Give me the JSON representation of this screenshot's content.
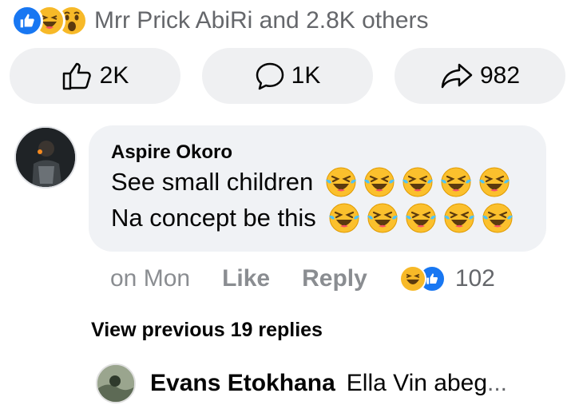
{
  "summary": {
    "reactions": [
      "like-icon",
      "haha-icon",
      "wow-icon"
    ],
    "text": "Mrr Prick AbiRi and 2.8K others"
  },
  "actions": {
    "like_count": "2K",
    "comment_count": "1K",
    "share_count": "982"
  },
  "comment": {
    "author": "Aspire Okoro",
    "line1": "See small children",
    "line2": "Na concept be this",
    "line1_emoji_count": 5,
    "line2_emoji_count": 5,
    "time": "on Mon",
    "like_label": "Like",
    "reply_label": "Reply",
    "reaction_count": "102"
  },
  "view_previous": "View previous 19 replies",
  "reply": {
    "author": "Evans Etokhana",
    "text": "Ella Vin abeg",
    "ellipsis": "..."
  },
  "colors": {
    "accent": "#1877f2",
    "haha": "#f7b928",
    "bubble": "#f0f2f5",
    "muted": "#65676b"
  }
}
